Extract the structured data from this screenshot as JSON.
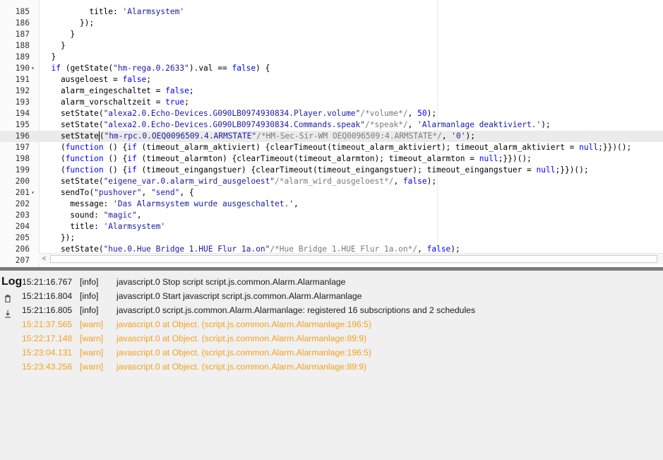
{
  "editor": {
    "active_line": "196",
    "lines": [
      {
        "num": "185",
        "fold": "",
        "tokens": [
          [
            "plain",
            "          title: "
          ],
          [
            "sq",
            "'Alarmsystem'"
          ]
        ]
      },
      {
        "num": "186",
        "fold": "",
        "tokens": [
          [
            "plain",
            "        });"
          ]
        ]
      },
      {
        "num": "187",
        "fold": "",
        "tokens": [
          [
            "plain",
            "      }"
          ]
        ]
      },
      {
        "num": "188",
        "fold": "",
        "tokens": [
          [
            "plain",
            "    }"
          ]
        ]
      },
      {
        "num": "189",
        "fold": "",
        "tokens": [
          [
            "plain",
            "  }"
          ]
        ]
      },
      {
        "num": "190",
        "fold": "▾",
        "tokens": [
          [
            "plain",
            "  "
          ],
          [
            "kw",
            "if"
          ],
          [
            "plain",
            " (getState("
          ],
          [
            "str",
            "\"hm-rega.0.2633\""
          ],
          [
            "plain",
            ").val == "
          ],
          [
            "kw",
            "false"
          ],
          [
            "plain",
            ") {"
          ]
        ]
      },
      {
        "num": "191",
        "fold": "",
        "tokens": [
          [
            "plain",
            "    ausgeloest = "
          ],
          [
            "kw",
            "false"
          ],
          [
            "plain",
            ";"
          ]
        ]
      },
      {
        "num": "192",
        "fold": "",
        "tokens": [
          [
            "plain",
            "    alarm_eingeschaltet = "
          ],
          [
            "kw",
            "false"
          ],
          [
            "plain",
            ";"
          ]
        ]
      },
      {
        "num": "193",
        "fold": "",
        "tokens": [
          [
            "plain",
            "    alarm_vorschaltzeit = "
          ],
          [
            "kw",
            "true"
          ],
          [
            "plain",
            ";"
          ]
        ]
      },
      {
        "num": "194",
        "fold": "",
        "tokens": [
          [
            "plain",
            "    setState("
          ],
          [
            "str",
            "\"alexa2.0.Echo-Devices.G090LB0974930834.Player.volume\""
          ],
          [
            "cm",
            "/*volume*/"
          ],
          [
            "plain",
            ", "
          ],
          [
            "kw",
            "50"
          ],
          [
            "plain",
            ");"
          ]
        ]
      },
      {
        "num": "195",
        "fold": "",
        "tokens": [
          [
            "plain",
            "    setState("
          ],
          [
            "str",
            "\"alexa2.0.Echo-Devices.G090LB0974930834.Commands.speak\""
          ],
          [
            "cm",
            "/*speak*/"
          ],
          [
            "plain",
            ", "
          ],
          [
            "sq",
            "'Alarmanlage deaktiviert.'"
          ],
          [
            "plain",
            ");"
          ]
        ]
      },
      {
        "num": "196",
        "fold": "",
        "tokens": [
          [
            "plain",
            "    setState"
          ],
          [
            "cursor",
            ""
          ],
          [
            "plain",
            "("
          ],
          [
            "str",
            "\"hm-rpc.0.OEQ0096509.4.ARMSTATE\""
          ],
          [
            "cm",
            "/*HM-Sec-Sir-WM OEQ0096509:4.ARMSTATE*/"
          ],
          [
            "plain",
            ", "
          ],
          [
            "sq",
            "'0'"
          ],
          [
            "plain",
            ");"
          ]
        ]
      },
      {
        "num": "197",
        "fold": "",
        "tokens": [
          [
            "plain",
            "    ("
          ],
          [
            "kw",
            "function"
          ],
          [
            "plain",
            " () {"
          ],
          [
            "kw",
            "if"
          ],
          [
            "plain",
            " (timeout_alarm_aktiviert) {clearTimeout(timeout_alarm_aktiviert); timeout_alarm_aktiviert = "
          ],
          [
            "kw",
            "null"
          ],
          [
            "plain",
            ";}})();"
          ]
        ]
      },
      {
        "num": "198",
        "fold": "",
        "tokens": [
          [
            "plain",
            "    ("
          ],
          [
            "kw",
            "function"
          ],
          [
            "plain",
            " () {"
          ],
          [
            "kw",
            "if"
          ],
          [
            "plain",
            " (timeout_alarmton) {clearTimeout(timeout_alarmton); timeout_alarmton = "
          ],
          [
            "kw",
            "null"
          ],
          [
            "plain",
            ";}})();"
          ]
        ]
      },
      {
        "num": "199",
        "fold": "",
        "tokens": [
          [
            "plain",
            "    ("
          ],
          [
            "kw",
            "function"
          ],
          [
            "plain",
            " () {"
          ],
          [
            "kw",
            "if"
          ],
          [
            "plain",
            " (timeout_eingangstuer) {clearTimeout(timeout_eingangstuer); timeout_eingangstuer = "
          ],
          [
            "kw",
            "null"
          ],
          [
            "plain",
            ";}})();"
          ]
        ]
      },
      {
        "num": "200",
        "fold": "",
        "tokens": [
          [
            "plain",
            "    setState("
          ],
          [
            "str",
            "\"eigene_var.0.alarm_wird_ausgeloest\""
          ],
          [
            "cm",
            "/*alarm_wird_ausgeloest*/"
          ],
          [
            "plain",
            ", "
          ],
          [
            "kw",
            "false"
          ],
          [
            "plain",
            ");"
          ]
        ]
      },
      {
        "num": "201",
        "fold": "▾",
        "tokens": [
          [
            "plain",
            "    sendTo("
          ],
          [
            "str",
            "\"pushover\""
          ],
          [
            "plain",
            ", "
          ],
          [
            "str",
            "\"send\""
          ],
          [
            "plain",
            ", {"
          ]
        ]
      },
      {
        "num": "202",
        "fold": "",
        "tokens": [
          [
            "plain",
            "      message: "
          ],
          [
            "sq",
            "'Das Alarmsystem wurde ausgeschaltet.'"
          ],
          [
            "plain",
            ","
          ]
        ]
      },
      {
        "num": "203",
        "fold": "",
        "tokens": [
          [
            "plain",
            "      sound: "
          ],
          [
            "str",
            "\"magic\""
          ],
          [
            "plain",
            ","
          ]
        ]
      },
      {
        "num": "204",
        "fold": "",
        "tokens": [
          [
            "plain",
            "      title: "
          ],
          [
            "sq",
            "'Alarmsystem'"
          ]
        ]
      },
      {
        "num": "205",
        "fold": "",
        "tokens": [
          [
            "plain",
            "    });"
          ]
        ]
      },
      {
        "num": "206",
        "fold": "",
        "tokens": [
          [
            "plain",
            "    setState("
          ],
          [
            "str",
            "\"hue.0.Hue_Bridge_1.HUE_Flur_1a.on\""
          ],
          [
            "cm",
            "/*Hue Bridge 1.HUE Flur 1a.on*/"
          ],
          [
            "plain",
            ", "
          ],
          [
            "kw",
            "false"
          ],
          [
            "plain",
            ");"
          ]
        ]
      },
      {
        "num": "207",
        "fold": "",
        "tokens": []
      }
    ]
  },
  "scrollbar": {
    "left_arrow": "<"
  },
  "log": {
    "title": "Log",
    "icons": [
      "trash-icon",
      "download-icon"
    ],
    "entries": [
      {
        "time": "15:21:16.767",
        "level": "[info]",
        "message": "javascript.0 Stop script script.js.common.Alarm.Alarmanlage",
        "kind": "info"
      },
      {
        "time": "15:21:16.804",
        "level": "[info]",
        "message": "javascript.0 Start javascript script.js.common.Alarm.Alarmanlage",
        "kind": "info"
      },
      {
        "time": "15:21:16.805",
        "level": "[info]",
        "message": "javascript.0 script.js.common.Alarm.Alarmanlage: registered 16 subscriptions and 2 schedules",
        "kind": "info"
      },
      {
        "time": "15:21:37.565",
        "level": "[warn]",
        "message": "javascript.0 at Object. (script.js.common.Alarm.Alarmanlage:196:5)",
        "kind": "warn"
      },
      {
        "time": "15:22:17.148",
        "level": "[warn]",
        "message": "javascript.0 at Object. (script.js.common.Alarm.Alarmanlage:89:9)",
        "kind": "warn"
      },
      {
        "time": "15:23:04.131",
        "level": "[warn]",
        "message": "javascript.0 at Object. (script.js.common.Alarm.Alarmanlage:196:5)",
        "kind": "warn"
      },
      {
        "time": "15:23:43.256",
        "level": "[warn]",
        "message": "javascript.0 at Object. (script.js.common.Alarm.Alarmanlage:89:9)",
        "kind": "warn"
      }
    ]
  },
  "colors": {
    "warn": "#f5a020",
    "info": "#1a1a1a",
    "keyword": "#0000ff",
    "string": "#1a1aa6",
    "comment": "#7a7a7a"
  }
}
